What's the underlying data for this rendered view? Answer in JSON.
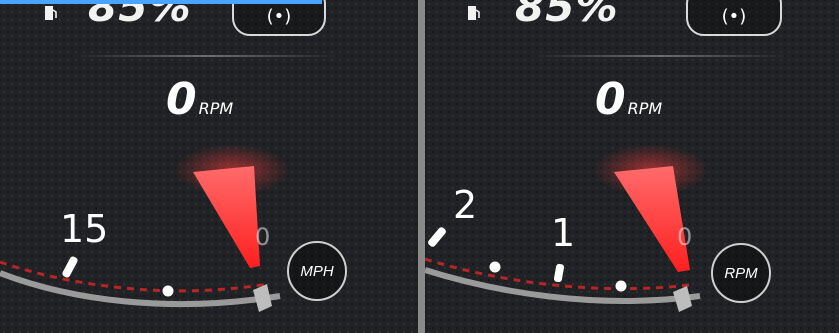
{
  "left_panel": {
    "fuel_percent": "85%",
    "rpm_value": "0",
    "rpm_unit": "RPM",
    "tick_label": "15",
    "unit_button_label": "MPH",
    "mode_glyph": "(•)"
  },
  "right_panel": {
    "fuel_percent": "85%",
    "rpm_value": "0",
    "rpm_unit": "RPM",
    "tick_label_major": "2",
    "tick_label_minor": "1",
    "unit_button_label": "RPM",
    "mode_glyph": "(•)"
  },
  "colors": {
    "accent_red": "#ff2a2a",
    "panel_bg": "#202225",
    "highlight_blue": "#4aa3ff"
  },
  "icons": {
    "fuel": "fuel-pump-icon",
    "mode": "engine-mode-icon"
  }
}
